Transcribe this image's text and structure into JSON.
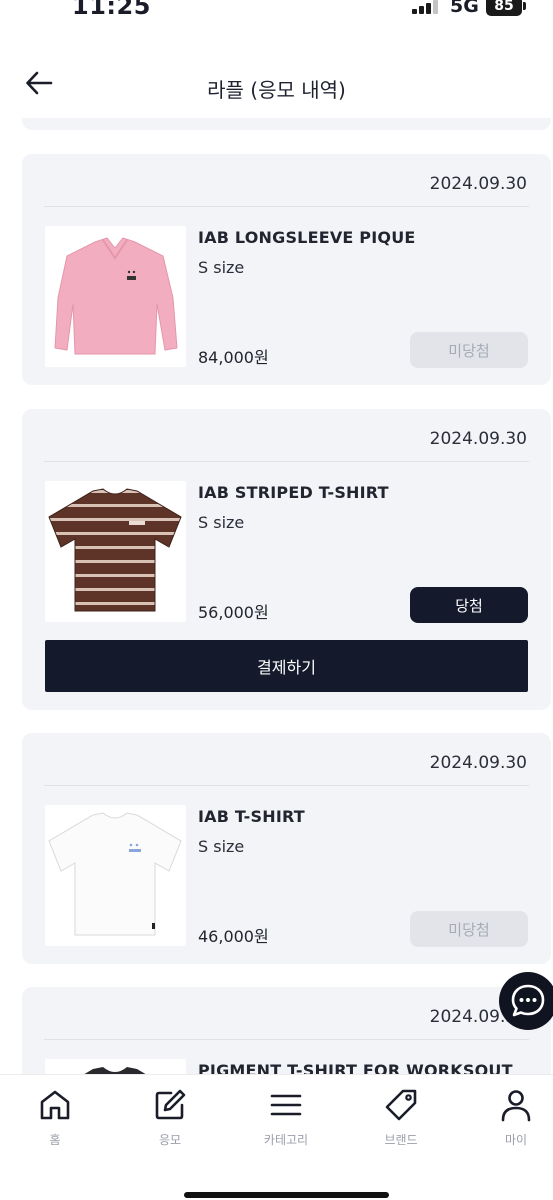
{
  "status_bar": {
    "time": "11:25",
    "network": "5G",
    "battery": "85"
  },
  "header": {
    "title": "라플 (응모 내역)",
    "back_icon": "arrow-left-icon"
  },
  "entries": [
    {
      "date": "2024.09.30",
      "name": "IAB LONGSLEEVE PIQUE",
      "size": "S size",
      "price": "84,000원",
      "result": "미당첨",
      "thumbnail": "pink-longsleeve-polo-image"
    },
    {
      "date": "2024.09.30",
      "name": "IAB STRIPED T-SHIRT",
      "size": "S size",
      "price": "56,000원",
      "result": "당첨",
      "pay_label": "결제하기",
      "thumbnail": "brown-striped-tshirt-image"
    },
    {
      "date": "2024.09.30",
      "name": "IAB T-SHIRT",
      "size": "S size",
      "price": "46,000원",
      "result": "미당첨",
      "thumbnail": "white-tshirt-image"
    },
    {
      "date": "2024.09.30",
      "name": "PIGMENT T-SHIRT FOR WORKSOUT",
      "thumbnail": "pigment-tshirt-image"
    }
  ],
  "chat_icon": "chat-bubble-icon",
  "bottom_nav": [
    {
      "label": "홈",
      "icon": "home-icon"
    },
    {
      "label": "응모",
      "icon": "edit-icon"
    },
    {
      "label": "카테고리",
      "icon": "menu-icon"
    },
    {
      "label": "브랜드",
      "icon": "tag-icon"
    },
    {
      "label": "마이",
      "icon": "user-icon"
    }
  ],
  "colors": {
    "primary": "#141a2c",
    "card_bg": "#f3f4f7",
    "lost_badge_bg": "#e2e4e9",
    "lost_badge_text": "#a7abb5",
    "nav_label": "#9a9ea8"
  }
}
